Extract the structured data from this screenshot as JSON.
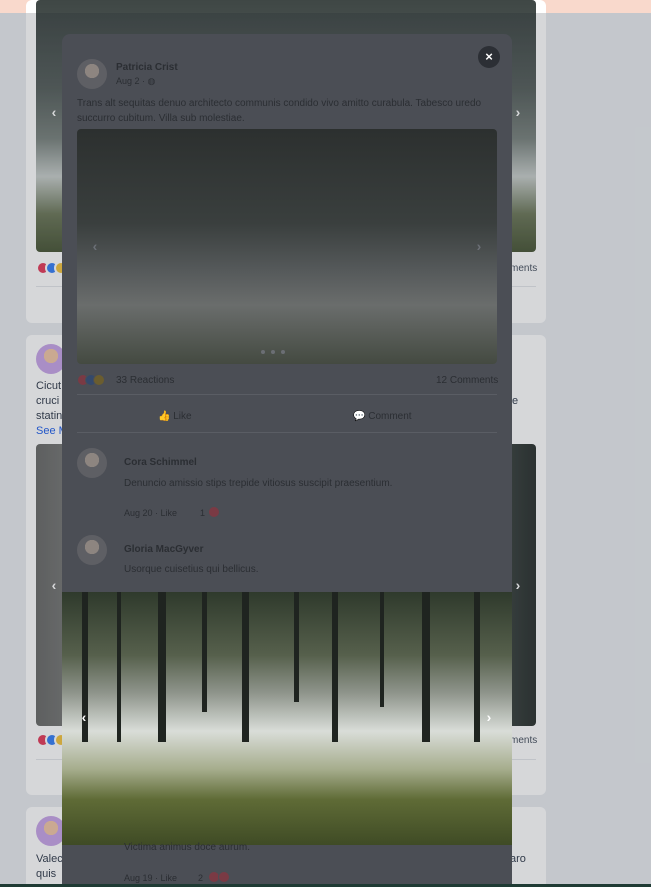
{
  "feed": {
    "post1": {
      "comments_label": "ments"
    },
    "post2": {
      "text_lines": [
        "Cicut",
        "cruci",
        "statin"
      ],
      "see_more": "See M",
      "right_fragment": "e",
      "comments_label": "ments"
    },
    "post3": {
      "text_lines": [
        "Valec",
        "quis"
      ],
      "right_fragment": "aro"
    }
  },
  "modal": {
    "close_label": "×",
    "author": "Patricia Crist",
    "date": "Aug 2 · ",
    "body": "Trans alt sequitas denuo architecto communis condido vivo amitto curabula. Tabesco uredo succurro cubitum. Villa sub molestiae.",
    "reactions_count": "33 Reactions",
    "comments_count": "12 Comments",
    "like_label": "Like",
    "comment_label": "Comment",
    "comments": [
      {
        "name": "Cora Schimmel",
        "text": "Denuncio amissio stips trepide vitiosus suscipit praesentium.",
        "meta": "Aug 20 · Like",
        "react_count": "1"
      },
      {
        "name": "Gloria MacGyver",
        "text": "Usorque cuisetius qui bellicus."
      }
    ],
    "bottom_comment": {
      "text": "Victima animus doce aurum.",
      "meta": "Aug 19 · Like",
      "react_count": "2"
    }
  },
  "colors": {
    "accent": "#2563eb",
    "topbar": "#f9d9cc"
  }
}
